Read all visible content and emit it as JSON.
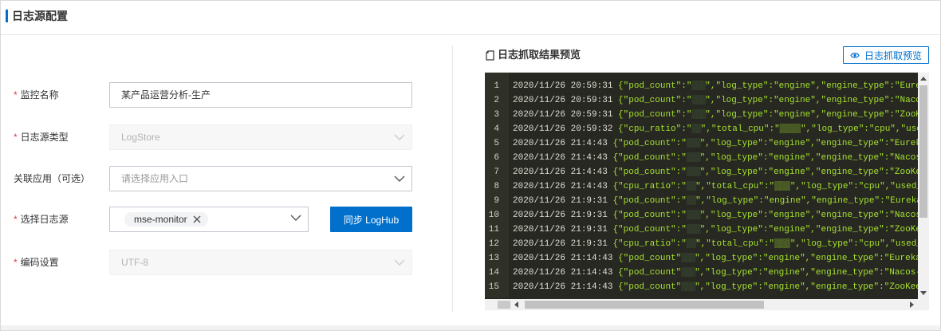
{
  "header": {
    "title": "日志源配置"
  },
  "form": {
    "monitor_name": {
      "label": "监控名称",
      "required": true,
      "value": "某产品运营分析-生产"
    },
    "log_source_type": {
      "label": "日志源类型",
      "required": true,
      "value": "LogStore",
      "disabled": true
    },
    "associated_app": {
      "label": "关联应用（可选）",
      "required": false,
      "placeholder": "请选择应用入口"
    },
    "select_log_source": {
      "label": "选择日志源",
      "required": true,
      "tag": "mse-monitor"
    },
    "sync_button": "同步 LogHub",
    "encoding": {
      "label": "编码设置",
      "required": true,
      "value": "UTF-8",
      "disabled": true
    }
  },
  "preview": {
    "title": "日志抓取结果预览",
    "button_label": "日志抓取预览",
    "lines": [
      {
        "n": "1",
        "ts": "2020/11/26 20:59:31",
        "json": "{\"pod_count\":\"",
        "mask": "▒▒▒",
        "rest": "\",\"log_type\":\"engine\",\"engine_type\":\"Eureka\""
      },
      {
        "n": "2",
        "ts": "2020/11/26 20:59:31",
        "json": "{\"pod_count\":\"",
        "mask": "▒▒▒",
        "rest": "\",\"log_type\":\"engine\",\"engine_type\":\"Nacos-A"
      },
      {
        "n": "3",
        "ts": "2020/11/26 20:59:31",
        "json": "{\"pod_count\":\"",
        "mask": "▒▒▒",
        "rest": "\",\"log_type\":\"engine\",\"engine_type\":\"ZooKee"
      },
      {
        "n": "4",
        "ts": "2020/11/26 20:59:32",
        "json": "{\"cpu_ratio\":\"",
        "mask": "▒▒",
        "rest": "\",\"total_cpu\":\"▒▒▒▒\",\"log_type\":\"cpu\",\"used_"
      },
      {
        "n": "5",
        "ts": "2020/11/26 21:4:43",
        "json": "{\"pod_count\":\"",
        "mask": "▒▒▒",
        "rest": "\",\"log_type\":\"engine\",\"engine_type\":\"Eureka\","
      },
      {
        "n": "6",
        "ts": "2020/11/26 21:4:43",
        "json": "{\"pod_count\":\"",
        "mask": "▒▒▒",
        "rest": "\",\"log_type\":\"engine\",\"engine_type\":\"Nacos-A"
      },
      {
        "n": "7",
        "ts": "2020/11/26 21:4:43",
        "json": "{\"pod_count\":\"",
        "mask": "▒▒▒",
        "rest": "\",\"log_type\":\"engine\",\"engine_type\":\"ZooKeep"
      },
      {
        "n": "8",
        "ts": "2020/11/26 21:4:43",
        "json": "{\"cpu_ratio\":\"",
        "mask": "▒▒",
        "rest": "\",\"total_cpu\":\"▒▒▒\",\"log_type\":\"cpu\",\"used_"
      },
      {
        "n": "9",
        "ts": "2020/11/26 21:9:31",
        "json": "{\"pod_count\":\"",
        "mask": "▒▒",
        "rest": "\",\"log_type\":\"engine\",\"engine_type\":\"Eureka\","
      },
      {
        "n": "10",
        "ts": "2020/11/26 21:9:31",
        "json": "{\"pod_count\":\"",
        "mask": "▒▒▒",
        "rest": "\",\"log_type\":\"engine\",\"engine_type\":\"Nacos-A"
      },
      {
        "n": "11",
        "ts": "2020/11/26 21:9:31",
        "json": "{\"pod_count\":\"",
        "mask": "▒▒▒",
        "rest": "\",\"log_type\":\"engine\",\"engine_type\":\"ZooKeep"
      },
      {
        "n": "12",
        "ts": "2020/11/26 21:9:31",
        "json": "{\"cpu_ratio\":\"",
        "mask": "▒▒",
        "rest": "\",\"total_cpu\":\"▒▒▒\",\"log_type\":\"cpu\",\"used_"
      },
      {
        "n": "13",
        "ts": "2020/11/26 21:14:43",
        "json": "{\"pod_count\"",
        "mask": "▒▒▒",
        "rest": "\",\"log_type\":\"engine\",\"engine_type\":\"Eureka\""
      },
      {
        "n": "14",
        "ts": "2020/11/26 21:14:43",
        "json": "{\"pod_count\"",
        "mask": "▒▒▒",
        "rest": "\",\"log_type\":\"engine\",\"engine_type\":\"Nacos-"
      },
      {
        "n": "15",
        "ts": "2020/11/26 21:14:43",
        "json": "{\"pod_count\"",
        "mask": "▒▒▒",
        "rest": "\",\"log_type\":\"engine\",\"engine_type\":\"ZooKee"
      }
    ]
  },
  "colors": {
    "primary": "#0070cc",
    "required": "#e4393c",
    "console_bg": "#272822",
    "json_green": "#a6e22e"
  },
  "icons": {
    "chevron": "chevron-down-icon",
    "tag_close": "close-icon",
    "doc": "document-icon",
    "eye": "eye-icon"
  }
}
